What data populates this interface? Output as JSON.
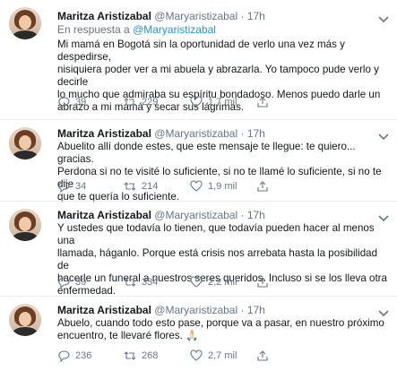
{
  "tweets": [
    {
      "name": "Maritza Aristizabal",
      "handle": "@Maryaristizabal",
      "dot": "·",
      "time": "17h",
      "reply_prefix": "En respuesta a",
      "reply_handle": "@Maryaristizabal",
      "text": "Mi mamá en Bogotá sin la oportunidad de verlo una vez más y despedirse,\nnisiquiera poder ver a mi abuela y abrazarla. Yo tampoco pude verlo y decirle\nlo mucho que admiraba su espíritu bondadoso. Menos puedo darle un\nabrazo a mi mamá y secar sus lágrimas.",
      "replies": "39",
      "retweets": "229",
      "likes": "1,7 mil"
    },
    {
      "name": "Maritza Aristizabal",
      "handle": "@Maryaristizabal",
      "dot": "·",
      "time": "17h",
      "text": "Abuelito allí donde estes, que este mensaje te llegue: te quiero... gracias.\nPerdona si no te visité lo suficiente, si no te llamé lo suficiente, si no te dije\nque te quería lo suficiente.",
      "replies": "34",
      "retweets": "214",
      "likes": "1,9 mil"
    },
    {
      "name": "Maritza Aristizabal",
      "handle": "@Maryaristizabal",
      "dot": "·",
      "time": "17h",
      "text": "Y ustedes que todavía lo tienen, que todavía pueden hacer al menos una\nllamada, háganlo. Porque está crisis nos arrebata hasta la posibilidad de\nhacerle un funeral a nuestros seres queridos. Incluso si se los lleva otra\nenfermedad.",
      "replies": "39",
      "retweets": "334",
      "likes": "2,2 mil"
    },
    {
      "name": "Maritza Aristizabal",
      "handle": "@Maryaristizabal",
      "dot": "·",
      "time": "17h",
      "text": "Abuelo, cuando todo esto pase, porque va a pasar, en nuestro próximo\nencuentro, te llevaré flores. 🙏🏻",
      "replies": "236",
      "retweets": "268",
      "likes": "2,7 mil"
    }
  ],
  "colors": {
    "text": "#14171a",
    "muted": "#657786",
    "link": "#1b95e0",
    "separator": "#e6ecf0"
  },
  "icons": [
    "avatar",
    "reply-icon",
    "retweet-icon",
    "like-icon",
    "share-icon",
    "caret-down-icon"
  ]
}
